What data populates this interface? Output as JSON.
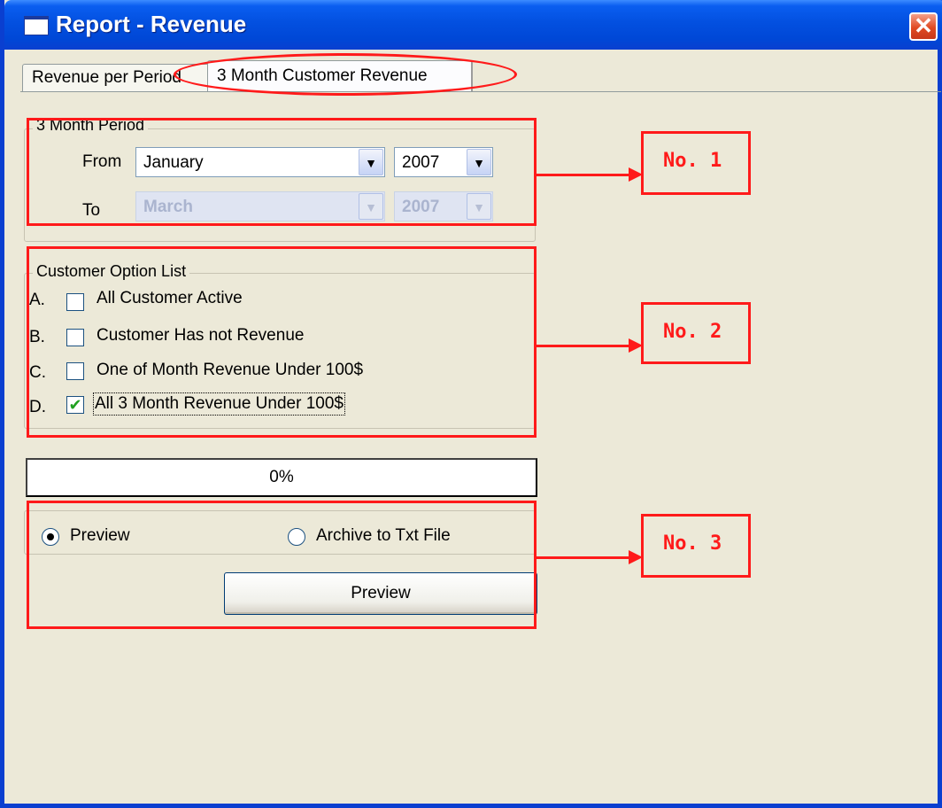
{
  "window": {
    "title": "Report - Revenue",
    "close_symbol": "✕",
    "icon": "window-app-icon",
    "close_icon": "close-icon"
  },
  "tabs": [
    {
      "label": "Revenue per Period",
      "selected": false
    },
    {
      "label": "3 Month Customer Revenue",
      "selected": true
    }
  ],
  "period_group": {
    "title": "3 Month Period",
    "from_label": "From",
    "to_label": "To",
    "from_month": "January",
    "from_year": "2007",
    "to_month": "March",
    "to_year": "2007",
    "to_disabled": true
  },
  "customer_group": {
    "title": "Customer Option List",
    "options": [
      {
        "letter": "A.",
        "label": "All Customer Active",
        "checked": false
      },
      {
        "letter": "B.",
        "label": "Customer Has not Revenue",
        "checked": false
      },
      {
        "letter": "C.",
        "label": "One of Month Revenue Under 100$",
        "checked": false
      },
      {
        "letter": "D.",
        "label": "All 3 Month Revenue Under 100$",
        "checked": true
      }
    ]
  },
  "progress": {
    "text": "0%",
    "value": 0
  },
  "output": {
    "preview_radio": "Preview",
    "archive_radio": "Archive to Txt File",
    "selected": "Preview",
    "button_label": "Preview"
  },
  "annotations": [
    {
      "label": "No. 1"
    },
    {
      "label": "No. 2"
    },
    {
      "label": "No. 3"
    }
  ],
  "colors": {
    "annotation": "#ff1a1a",
    "titlebar": "#0350e0",
    "window_bg": "#ece9d8"
  },
  "glyphs": {
    "dropdown_arrow": "▼",
    "check": "✔"
  }
}
